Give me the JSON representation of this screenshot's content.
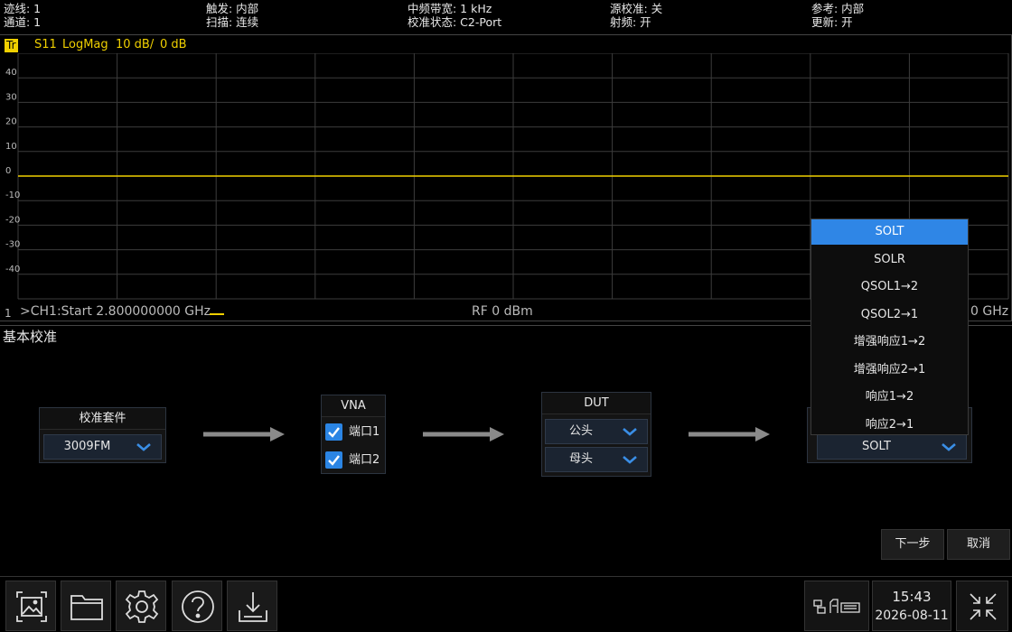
{
  "status": {
    "trace": "迹线: 1",
    "channel": "通道: 1",
    "trigger": "触发: 内部",
    "sweep": "扫描: 连续",
    "if_bw": "中频带宽: 1 kHz",
    "cal_state": "校准状态: C2-Port",
    "source_cal": "源校准: 关",
    "rf": "射频: 开",
    "reference": "参考: 内部",
    "update": "更新: 开"
  },
  "trace_header": {
    "tag": "Tr 1",
    "param": "S11",
    "format": "LogMag",
    "scale": "10 dB/",
    "ref": "0 dB"
  },
  "plot": {
    "channel_marker": "1",
    "start": ">CH1:Start 2.800000000 GHz",
    "rf_power": "RF 0 dBm",
    "stop_partial": "0 GHz",
    "y_ticks": [
      "40",
      "30",
      "20",
      "10",
      "0",
      "-10",
      "-20",
      "-30",
      "-40"
    ],
    "trace_color": "#f0d000",
    "trace_level_db": 0,
    "grid": true
  },
  "cal": {
    "title": "基本校准",
    "kit": {
      "label": "校准套件",
      "value": "3009FM"
    },
    "vna": {
      "label": "VNA",
      "port1": "端口1",
      "port2": "端口2",
      "port1_checked": true,
      "port2_checked": true
    },
    "dut": {
      "label": "DUT",
      "connector1": "公头",
      "connector2": "母头"
    },
    "method": {
      "value": "SOLT"
    },
    "next_button": "下一步",
    "cancel_button": "取消"
  },
  "dropdown": {
    "items": [
      "SOLT",
      "SOLR",
      "QSOL1→2",
      "QSOL2→1",
      "增强响应1→2",
      "增强响应2→1",
      "响应1→2",
      "响应2→1"
    ],
    "selected_index": 0
  },
  "taskbar": {
    "time": "15:43",
    "date": "2026-08-11"
  },
  "colors": {
    "accent": "#2f86e6",
    "trace": "#f0d000",
    "checkbox": "#2b85e4"
  }
}
